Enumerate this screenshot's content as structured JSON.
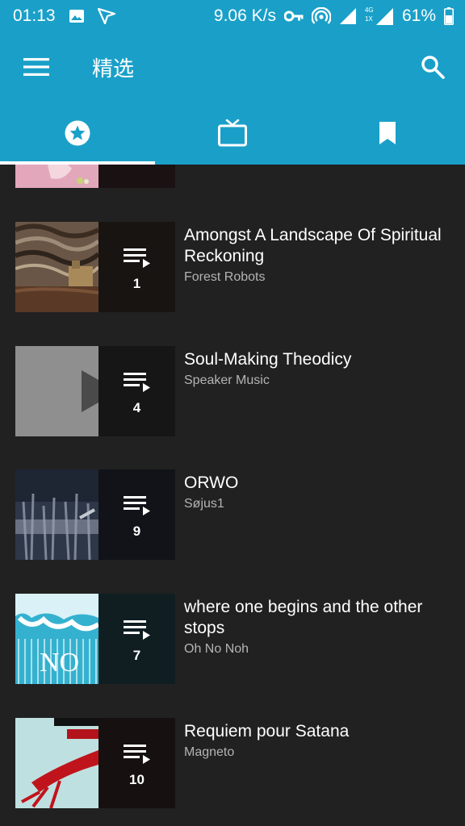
{
  "status": {
    "time": "01:13",
    "speed": "9.06 K/s",
    "network_small_top": "4G",
    "network_small_bottom": "1X",
    "battery": "61%"
  },
  "appbar": {
    "title": "精选"
  },
  "tabs": [
    {
      "icon": "star-circle-icon",
      "active": true
    },
    {
      "icon": "tv-icon",
      "active": false
    },
    {
      "icon": "bookmark-icon",
      "active": false
    }
  ],
  "albums": [
    {
      "title": "",
      "artist": "",
      "count": ""
    },
    {
      "title": "Amongst A Landscape Of Spiritual Reckoning",
      "artist": "Forest Robots",
      "count": "1"
    },
    {
      "title": "Soul-Making Theodicy",
      "artist": "Speaker Music",
      "count": "4"
    },
    {
      "title": "ORWO",
      "artist": "Søjus1",
      "count": "9"
    },
    {
      "title": "where one begins and the other stops",
      "artist": "Oh No Noh",
      "count": "7"
    },
    {
      "title": "Requiem pour Satana",
      "artist": "Magneto",
      "count": "10"
    }
  ],
  "colors": {
    "accent": "#1aa0c8",
    "background": "#212121"
  }
}
